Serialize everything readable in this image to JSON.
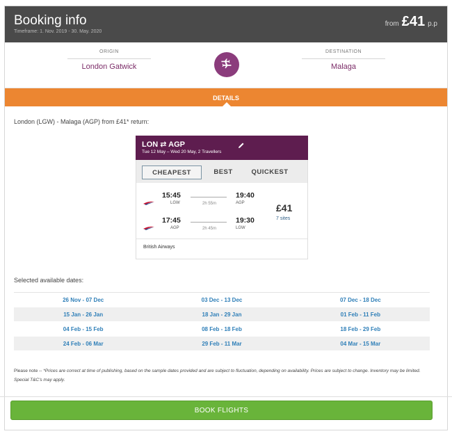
{
  "header": {
    "title": "Booking info",
    "timeframe": "Timeframe: 1. Nov. 2019 - 30. May. 2020",
    "price_prefix": "from",
    "price": "£41",
    "price_suffix": "p.p"
  },
  "route": {
    "origin_label": "ORIGIN",
    "origin_value": "London Gatwick",
    "destination_label": "DESTINATION",
    "destination_value": "Malaga",
    "plane_icon": "plane-icon"
  },
  "details_tab": {
    "label": "DETAILS"
  },
  "intro": "London (LGW) - Malaga (AGP) from £41* return:",
  "widget": {
    "route": "LON ⇄ AGP",
    "subtitle": "Tue 12 May – Wed 20 May, 2 Travellers",
    "tabs": [
      "CHEAPEST",
      "BEST",
      "QUICKEST"
    ],
    "outbound": {
      "depart_time": "15:45",
      "depart_airport": "LGW",
      "duration": "2h 55m",
      "arrive_time": "19:40",
      "arrive_airport": "AGP"
    },
    "inbound": {
      "depart_time": "17:45",
      "depart_airport": "AGP",
      "duration": "2h 45m",
      "arrive_time": "19:30",
      "arrive_airport": "LGW"
    },
    "price": "£41",
    "sites": "7 sites",
    "airline": "British Airways"
  },
  "selected_dates_label": "Selected available dates:",
  "dates": [
    [
      "26 Nov - 07 Dec",
      "03 Dec - 13 Dec",
      "07 Dec - 18 Dec"
    ],
    [
      "15 Jan - 26 Jan",
      "18 Jan - 29 Jan",
      "01 Feb - 11 Feb"
    ],
    [
      "04 Feb - 15 Feb",
      "08 Feb - 18 Feb",
      "18 Feb - 29 Feb"
    ],
    [
      "24 Feb - 06 Mar",
      "29 Feb - 11 Mar",
      "04 Mar - 15 Mar"
    ]
  ],
  "note_prefix": "Please note -- ",
  "note": "*Prices are correct at time of publishing, based on the sample dates provided and are subject to fluctuation, depending on availability. Prices are subject to change. Inventory may be limited. Special T&C's may apply.",
  "book_button": "BOOK FLIGHTS",
  "colors": {
    "header_bg": "#4a4a4a",
    "accent_purple": "#8b3c7c",
    "details_orange": "#ec8631",
    "date_blue": "#2f7fb8",
    "book_green": "#69b43a"
  }
}
